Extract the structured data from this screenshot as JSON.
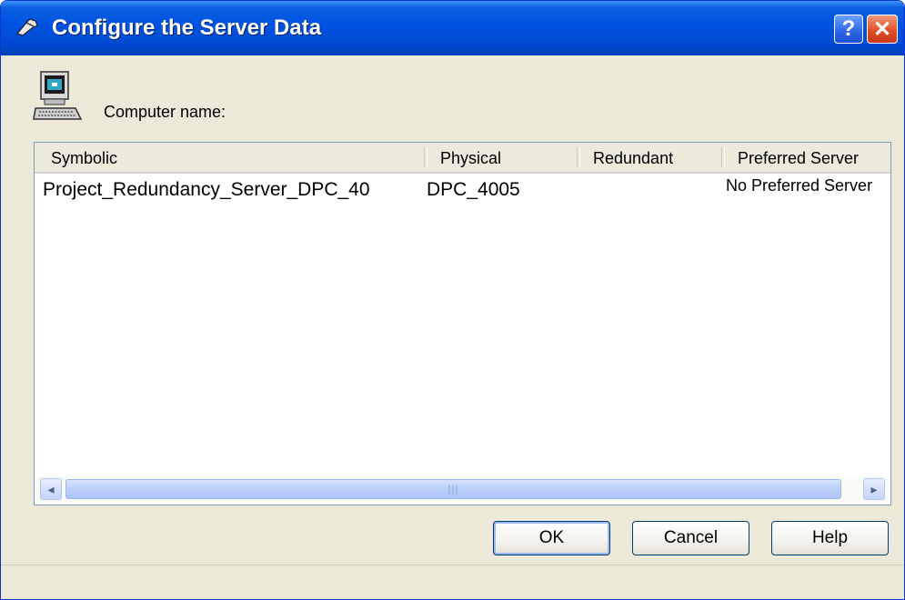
{
  "window": {
    "title": "Configure the Server Data",
    "help_button": "?",
    "close_button": "✕"
  },
  "computer": {
    "label": "Computer name:"
  },
  "table": {
    "columns": [
      "Symbolic",
      "Physical",
      "Redundant",
      "Preferred Server"
    ],
    "rows": [
      {
        "symbolic": "Project_Redundancy_Server_DPC_40",
        "physical": "DPC_4005",
        "redundant": "",
        "preferred": "No Preferred Server"
      }
    ]
  },
  "scrollbar": {
    "left_arrow": "◂",
    "right_arrow": "▸",
    "thumb_grip": "|||"
  },
  "buttons": {
    "ok": "OK",
    "cancel": "Cancel",
    "help": "Help"
  },
  "colors": {
    "titlebar": "#0054e3",
    "dialog_bg": "#ece9d8",
    "close_button": "#e0502a"
  },
  "icons": [
    "titlebar-server-icon",
    "computer-icon",
    "help-icon",
    "close-icon"
  ]
}
